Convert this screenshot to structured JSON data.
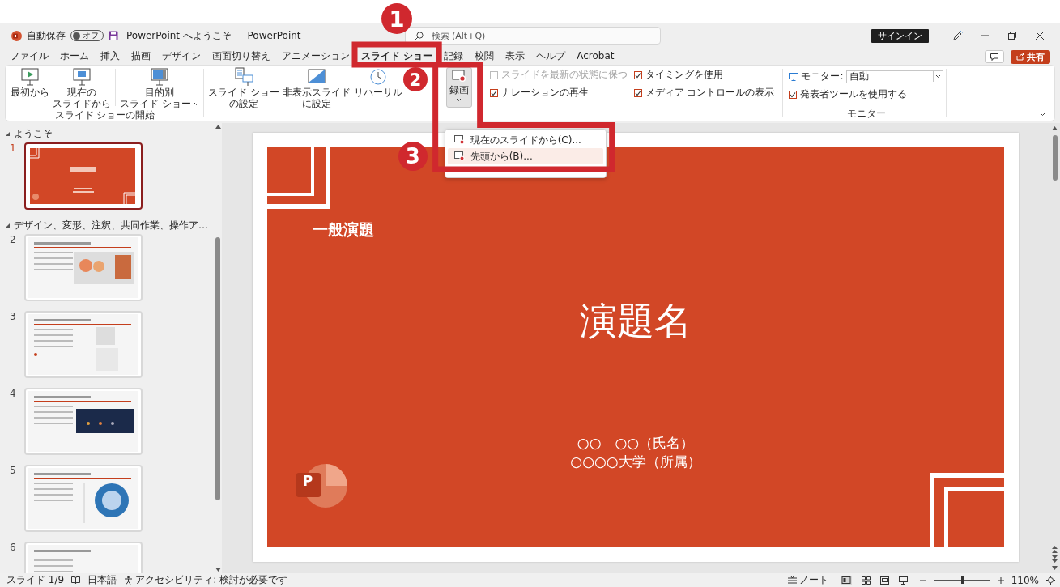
{
  "title_bar": {
    "autosave_label": "自動保存",
    "autosave": {
      "label": "オフ",
      "on": false
    },
    "document_title": "PowerPoint へようこそ  -  PowerPoint",
    "search": {
      "placeholder": "検索 (Alt+Q)"
    },
    "sign_in": "サインイン"
  },
  "tabs": [
    {
      "label": "ファイル",
      "selected": false
    },
    {
      "label": "ホーム",
      "selected": false
    },
    {
      "label": "挿入",
      "selected": false
    },
    {
      "label": "描画",
      "selected": false
    },
    {
      "label": "デザイン",
      "selected": false
    },
    {
      "label": "画面切り替え",
      "selected": false
    },
    {
      "label": "アニメーション",
      "selected": false
    },
    {
      "label": "スライド ショー",
      "selected": true
    },
    {
      "label": "記録",
      "selected": false
    },
    {
      "label": "校閲",
      "selected": false
    },
    {
      "label": "表示",
      "selected": false
    },
    {
      "label": "ヘルプ",
      "selected": false
    },
    {
      "label": "Acrobat",
      "selected": false
    }
  ],
  "share_button": "共有",
  "ribbon": {
    "start_group": {
      "label": "スライド ショーの開始",
      "buttons": [
        {
          "lines": [
            "最初から"
          ]
        },
        {
          "lines": [
            "現在の",
            "スライドから"
          ]
        },
        {
          "lines": [
            "目的別",
            "スライド ショー"
          ]
        }
      ]
    },
    "setup_buttons": [
      {
        "lines": [
          "スライド ショー",
          "の設定"
        ]
      },
      {
        "lines": [
          "非表示スライド",
          "に設定"
        ]
      },
      {
        "lines": [
          "リハーサル"
        ]
      }
    ],
    "record_button": {
      "label": "録画",
      "expanded": true
    },
    "options": [
      {
        "label": "スライドを最新の状態に保つ",
        "checked": false,
        "disabled": true
      },
      {
        "label": "ナレーションの再生",
        "checked": true,
        "disabled": false
      },
      {
        "label": "タイミングを使用",
        "checked": true,
        "disabled": false
      },
      {
        "label": "メディア コントロールの表示",
        "checked": true,
        "disabled": false
      }
    ],
    "monitor_group": {
      "label": "モニター",
      "monitor_label": "モニター:",
      "monitor_value": "自動",
      "presenter_view": {
        "label": "発表者ツールを使用する",
        "checked": true
      }
    }
  },
  "record_menu": {
    "items": [
      {
        "label": "現在のスライドから(C)...",
        "selected": false
      },
      {
        "label": "先頭から(B)...",
        "selected": true
      }
    ]
  },
  "slide_panel": {
    "sections": [
      {
        "label": "ようこそ",
        "expanded": true,
        "slides": [
          {
            "number": "1",
            "selected": true
          }
        ]
      },
      {
        "label": "デザイン、変形、注釈、共同作業、操作ア…",
        "expanded": true,
        "slides": [
          {
            "number": "2",
            "selected": false
          },
          {
            "number": "3",
            "selected": false
          },
          {
            "number": "4",
            "selected": false
          },
          {
            "number": "5",
            "selected": false
          },
          {
            "number": "6",
            "selected": false
          }
        ]
      }
    ]
  },
  "slide": {
    "tag": "一般演題",
    "title": "演題名",
    "presenter_lines": [
      "○○　○○（氏名）",
      "○○○○大学（所属）"
    ],
    "logo_letter": "P"
  },
  "status_bar": {
    "slide_count": "スライド 1/9",
    "language": "日本語",
    "accessibility": "アクセシビリティ: 検討が必要です",
    "notes": "ノート",
    "zoom": {
      "level": 0.5
    },
    "zoom_percent": "110%"
  },
  "annotations": [
    {
      "number": "1"
    },
    {
      "number": "2"
    },
    {
      "number": "3"
    }
  ]
}
